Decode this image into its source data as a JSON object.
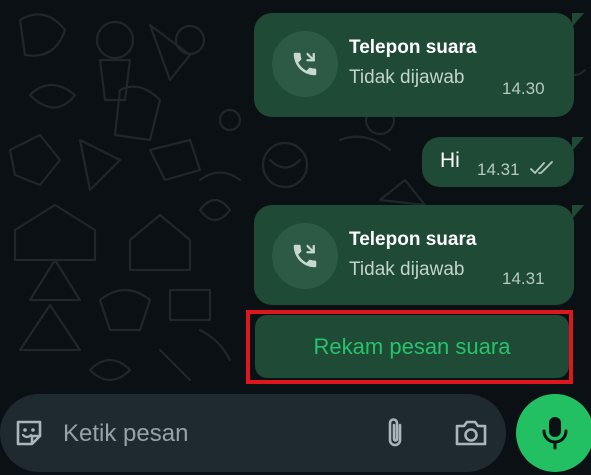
{
  "messages": [
    {
      "type": "call",
      "title": "Telepon suara",
      "status": "Tidak dijawab",
      "time": "14.30"
    },
    {
      "type": "text",
      "text": "Hi",
      "time": "14.31"
    },
    {
      "type": "call",
      "title": "Telepon suara",
      "status": "Tidak dijawab",
      "time": "14.31"
    }
  ],
  "record_button": {
    "label": "Rekam pesan suara"
  },
  "composer": {
    "placeholder": "Ketik pesan",
    "icons": [
      "sticker-icon",
      "attachment-icon",
      "camera-icon",
      "microphone-icon"
    ]
  },
  "colors": {
    "background": "#0b1014",
    "bubble": "#1e4a36",
    "accent": "#22c062",
    "highlight_border": "#e0161e"
  }
}
